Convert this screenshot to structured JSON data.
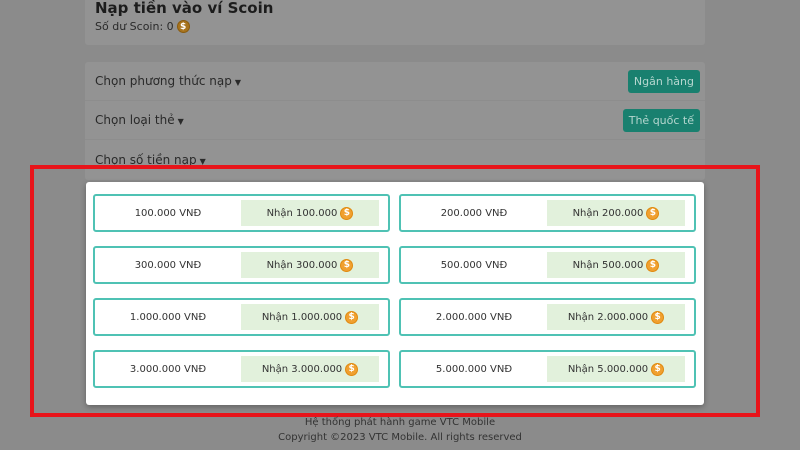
{
  "header": {
    "title": "Nạp tiền vào ví Scoin",
    "balance_label": "Số dư Scoin: 0",
    "coin_icon": "$"
  },
  "options": [
    {
      "label": "Chọn phương thức nạp",
      "button": "Ngân hàng"
    },
    {
      "label": "Chọn loại thẻ",
      "button": "Thẻ quốc tế"
    },
    {
      "label": "Chọn số tiền nạp"
    }
  ],
  "caret": "▼",
  "packages": [
    {
      "amount": "100.000 VNĐ",
      "receive": "Nhận 100.000"
    },
    {
      "amount": "200.000 VNĐ",
      "receive": "Nhận 200.000"
    },
    {
      "amount": "300.000 VNĐ",
      "receive": "Nhận 300.000"
    },
    {
      "amount": "500.000 VNĐ",
      "receive": "Nhận 500.000"
    },
    {
      "amount": "1.000.000 VNĐ",
      "receive": "Nhận 1.000.000"
    },
    {
      "amount": "2.000.000 VNĐ",
      "receive": "Nhận 2.000.000"
    },
    {
      "amount": "3.000.000 VNĐ",
      "receive": "Nhận 3.000.000"
    },
    {
      "amount": "5.000.000 VNĐ",
      "receive": "Nhận 5.000.000"
    }
  ],
  "footer": {
    "line1": "Hệ thống phát hành game VTC Mobile",
    "line2": "Copyright ©2023 VTC Mobile. All rights reserved"
  },
  "colors": {
    "accent": "#4fc2b4",
    "highlight": "#e8141a",
    "coin": "#f0a030"
  }
}
